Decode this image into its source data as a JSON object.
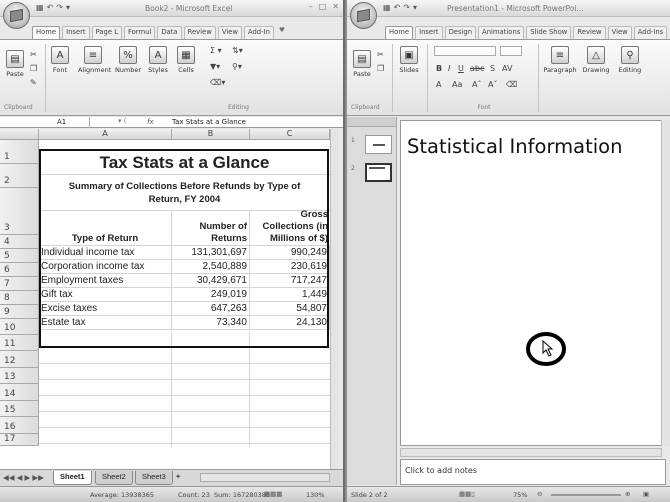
{
  "excel": {
    "title": "Book2 - Microsoft Excel",
    "tabs": [
      "Home",
      "Insert",
      "Page L",
      "Formul",
      "Data",
      "Review",
      "View",
      "Add-In"
    ],
    "ribbon": {
      "paste": "Paste",
      "font": "Font",
      "alignment": "Alignment",
      "number": "Number",
      "styles": "Styles",
      "cells": "Cells",
      "clipboard": "Clipboard",
      "editing": "Editing"
    },
    "name_box": "A1",
    "formula_value": "Tax Stats at a Glance",
    "columns": [
      "A",
      "B",
      "C"
    ],
    "rows": [
      "1",
      "2",
      "3",
      "4",
      "5",
      "6",
      "7",
      "8",
      "9",
      "10",
      "11",
      "12",
      "13",
      "14",
      "15",
      "16",
      "17"
    ],
    "table": {
      "title": "Tax Stats at a Glance",
      "subtitle": "Summary of Collections Before Refunds by Type of Return, FY 2004",
      "headers": [
        "Type of Return",
        "Number of Returns",
        "Gross Collections (in Millions of $)"
      ],
      "data": [
        [
          "Individual income tax",
          "131,301,697",
          "990,249"
        ],
        [
          "Corporation income tax",
          "2,540,889",
          "230,619"
        ],
        [
          "Employment taxes",
          "30,429,671",
          "717,247"
        ],
        [
          "Gift tax",
          "249,019",
          "1,449"
        ],
        [
          "Excise taxes",
          "647,263",
          "54,807"
        ],
        [
          "Estate tax",
          "73,340",
          "24,130"
        ]
      ]
    },
    "sheets": [
      "Sheet1",
      "Sheet2",
      "Sheet3"
    ],
    "status": {
      "average": "Average: 13938365",
      "count": "Count: 23",
      "sum": "Sum: 167280380",
      "zoom": "130%"
    }
  },
  "ppt": {
    "title": "Presentation1 - Microsoft PowerPoi...",
    "tabs": [
      "Home",
      "Insert",
      "Design",
      "Animations",
      "Slide Show",
      "Review",
      "View",
      "Add-Ins"
    ],
    "ribbon": {
      "paste": "Paste",
      "slides": "Slides",
      "font": "Font",
      "clipboard": "Clipboard",
      "paragraph": "Paragraph",
      "drawing": "Drawing",
      "editing": "Editing"
    },
    "thumb_numbers": [
      "1",
      "2"
    ],
    "slide_title": "Statistical Information",
    "notes_placeholder": "Click to add notes",
    "status": {
      "slide": "Slide 2 of 2",
      "zoom": "75%"
    }
  }
}
